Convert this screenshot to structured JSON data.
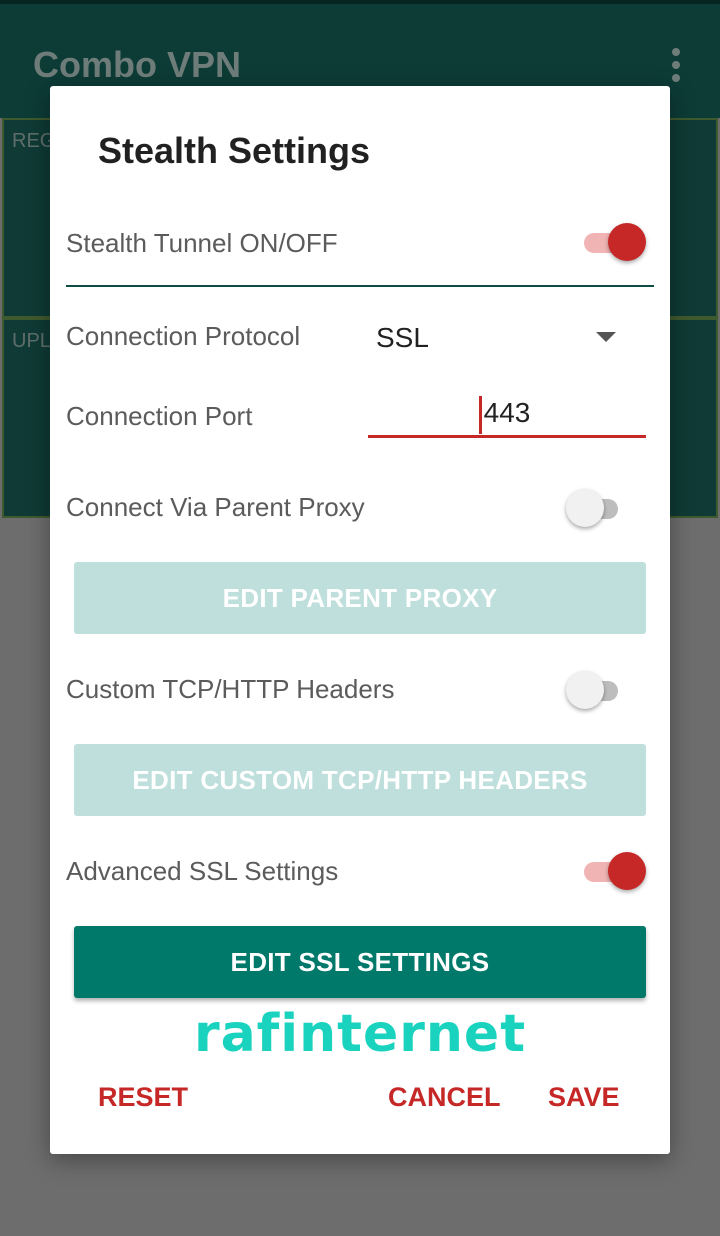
{
  "app": {
    "title": "Combo VPN",
    "panels": [
      {
        "label": "REG"
      },
      {
        "label": "UPL"
      }
    ]
  },
  "dialog": {
    "title": "Stealth Settings",
    "stealth_tunnel": {
      "label": "Stealth Tunnel ON/OFF",
      "enabled": true
    },
    "protocol": {
      "label": "Connection Protocol",
      "value": "SSL"
    },
    "port": {
      "label": "Connection Port",
      "value": "443"
    },
    "parent_proxy": {
      "label": "Connect Via Parent Proxy",
      "enabled": false,
      "button": "EDIT PARENT PROXY"
    },
    "custom_headers": {
      "label": "Custom TCP/HTTP Headers",
      "enabled": false,
      "button": "EDIT CUSTOM TCP/HTTP HEADERS"
    },
    "advanced_ssl": {
      "label": "Advanced SSL Settings",
      "enabled": true,
      "button": "EDIT SSL SETTINGS"
    },
    "watermark": "rafinternet",
    "actions": {
      "reset": "RESET",
      "cancel": "CANCEL",
      "save": "SAVE"
    }
  },
  "colors": {
    "accent": "#c62828",
    "primary": "#00796b",
    "disabled_button": "#bedfdb",
    "appbar": "#0d3b36"
  }
}
